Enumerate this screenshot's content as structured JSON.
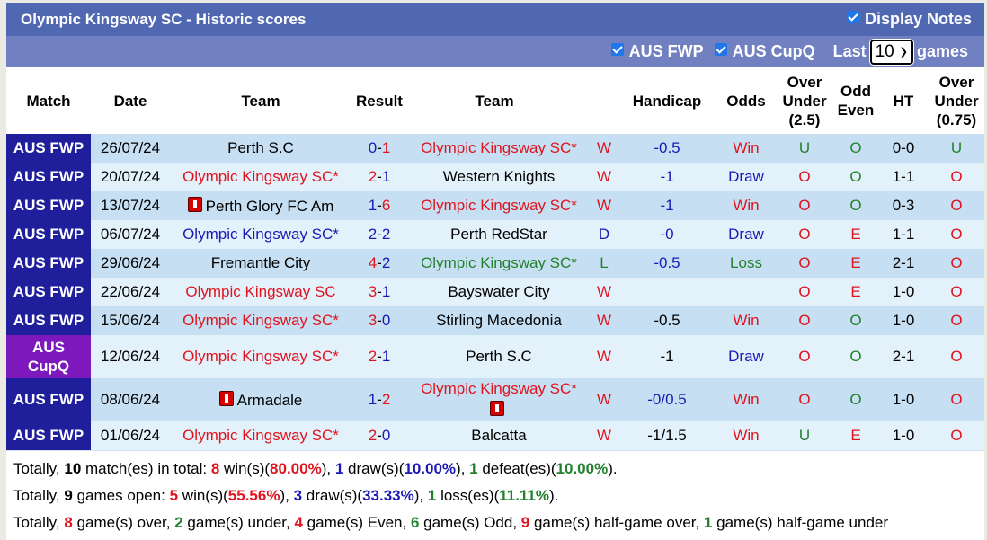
{
  "header": {
    "title": "Olympic Kingsway SC - Historic scores",
    "display_notes_label": "Display Notes",
    "display_notes_checked": true
  },
  "filters": {
    "aus_fwp_label": "AUS FWP",
    "aus_cupq_label": "AUS CupQ",
    "last_label": "Last",
    "games_count": "10",
    "games_label": "games"
  },
  "columns": {
    "match": "Match",
    "date": "Date",
    "home": "Team",
    "result": "Result",
    "away": "Team",
    "handicap": "Handicap",
    "odds": "Odds",
    "ou_l1": "Over",
    "ou_l2": "Under",
    "ou_l3": "(2.5)",
    "oe_l1": "Odd",
    "oe_l2": "Even",
    "ht": "HT",
    "ou2_l1": "Over",
    "ou2_l2": "Under",
    "ou2_l3": "(0.75)"
  },
  "rows": [
    {
      "league": "AUS FWP",
      "date": "26/07/24",
      "home": "Perth S.C",
      "home_color": "black",
      "home_card": false,
      "score_h": "0",
      "score_a": "1",
      "sh_color": "blue",
      "sa_color": "red",
      "away": "Olympic Kingsway SC*",
      "away_color": "red",
      "away_card": false,
      "wl": "W",
      "wl_color": "red",
      "handicap": "-0.5",
      "hc_color": "blue",
      "odds": "Win",
      "odds_color": "red",
      "ou": "U",
      "ou_color": "green",
      "oe": "O",
      "oe_color": "green",
      "ht": "0-0",
      "ou2": "U",
      "ou2_color": "green"
    },
    {
      "league": "AUS FWP",
      "date": "20/07/24",
      "home": "Olympic Kingsway SC*",
      "home_color": "red",
      "home_card": false,
      "score_h": "2",
      "score_a": "1",
      "sh_color": "red",
      "sa_color": "blue",
      "away": "Western Knights",
      "away_color": "black",
      "away_card": false,
      "wl": "W",
      "wl_color": "red",
      "handicap": "-1",
      "hc_color": "blue",
      "odds": "Draw",
      "odds_color": "blue",
      "ou": "O",
      "ou_color": "red",
      "oe": "O",
      "oe_color": "green",
      "ht": "1-1",
      "ou2": "O",
      "ou2_color": "red"
    },
    {
      "league": "AUS FWP",
      "date": "13/07/24",
      "home": "Perth Glory FC Am",
      "home_color": "black",
      "home_card": true,
      "score_h": "1",
      "score_a": "6",
      "sh_color": "blue",
      "sa_color": "red",
      "away": "Olympic Kingsway SC*",
      "away_color": "red",
      "away_card": false,
      "wl": "W",
      "wl_color": "red",
      "handicap": "-1",
      "hc_color": "blue",
      "odds": "Win",
      "odds_color": "red",
      "ou": "O",
      "ou_color": "red",
      "oe": "O",
      "oe_color": "green",
      "ht": "0-3",
      "ou2": "O",
      "ou2_color": "red"
    },
    {
      "league": "AUS FWP",
      "date": "06/07/24",
      "home": "Olympic Kingsway SC*",
      "home_color": "blue",
      "home_card": false,
      "score_h": "2",
      "score_a": "2",
      "sh_color": "blue",
      "sa_color": "blue",
      "away": "Perth RedStar",
      "away_color": "black",
      "away_card": false,
      "wl": "D",
      "wl_color": "blue",
      "handicap": "-0",
      "hc_color": "blue",
      "odds": "Draw",
      "odds_color": "blue",
      "ou": "O",
      "ou_color": "red",
      "oe": "E",
      "oe_color": "red",
      "ht": "1-1",
      "ou2": "O",
      "ou2_color": "red"
    },
    {
      "league": "AUS FWP",
      "date": "29/06/24",
      "home": "Fremantle City",
      "home_color": "black",
      "home_card": false,
      "score_h": "4",
      "score_a": "2",
      "sh_color": "red",
      "sa_color": "blue",
      "away": "Olympic Kingsway SC*",
      "away_color": "green",
      "away_card": false,
      "wl": "L",
      "wl_color": "green",
      "handicap": "-0.5",
      "hc_color": "blue",
      "odds": "Loss",
      "odds_color": "green",
      "ou": "O",
      "ou_color": "red",
      "oe": "E",
      "oe_color": "red",
      "ht": "2-1",
      "ou2": "O",
      "ou2_color": "red"
    },
    {
      "league": "AUS FWP",
      "date": "22/06/24",
      "home": "Olympic Kingsway SC",
      "home_color": "red",
      "home_card": false,
      "score_h": "3",
      "score_a": "1",
      "sh_color": "red",
      "sa_color": "blue",
      "away": "Bayswater City",
      "away_color": "black",
      "away_card": false,
      "wl": "W",
      "wl_color": "red",
      "handicap": "",
      "hc_color": "blue",
      "odds": "",
      "odds_color": "red",
      "ou": "O",
      "ou_color": "red",
      "oe": "E",
      "oe_color": "red",
      "ht": "1-0",
      "ou2": "O",
      "ou2_color": "red"
    },
    {
      "league": "AUS FWP",
      "date": "15/06/24",
      "home": "Olympic Kingsway SC*",
      "home_color": "red",
      "home_card": false,
      "score_h": "3",
      "score_a": "0",
      "sh_color": "red",
      "sa_color": "blue",
      "away": "Stirling Macedonia",
      "away_color": "black",
      "away_card": false,
      "wl": "W",
      "wl_color": "red",
      "handicap": "-0.5",
      "hc_color": "black",
      "odds": "Win",
      "odds_color": "red",
      "ou": "O",
      "ou_color": "red",
      "oe": "O",
      "oe_color": "green",
      "ht": "1-0",
      "ou2": "O",
      "ou2_color": "red"
    },
    {
      "league": "AUS CupQ",
      "league_l1": "AUS",
      "league_l2": "CupQ",
      "cup": true,
      "date": "12/06/24",
      "home": "Olympic Kingsway SC*",
      "home_color": "red",
      "home_card": false,
      "score_h": "2",
      "score_a": "1",
      "sh_color": "red",
      "sa_color": "blue",
      "away": "Perth S.C",
      "away_color": "black",
      "away_card": false,
      "wl": "W",
      "wl_color": "red",
      "handicap": "-1",
      "hc_color": "black",
      "odds": "Draw",
      "odds_color": "blue",
      "ou": "O",
      "ou_color": "red",
      "oe": "O",
      "oe_color": "green",
      "ht": "2-1",
      "ou2": "O",
      "ou2_color": "red"
    },
    {
      "league": "AUS FWP",
      "date": "08/06/24",
      "home": "Armadale",
      "home_color": "black",
      "home_card": true,
      "score_h": "1",
      "score_a": "2",
      "sh_color": "blue",
      "sa_color": "red",
      "away": "Olympic Kingsway SC*",
      "away_color": "red",
      "away_card": true,
      "wl": "W",
      "wl_color": "red",
      "handicap": "-0/0.5",
      "hc_color": "blue",
      "odds": "Win",
      "odds_color": "red",
      "ou": "O",
      "ou_color": "red",
      "oe": "O",
      "oe_color": "green",
      "ht": "1-0",
      "ou2": "O",
      "ou2_color": "red"
    },
    {
      "league": "AUS FWP",
      "date": "01/06/24",
      "home": "Olympic Kingsway SC*",
      "home_color": "red",
      "home_card": false,
      "score_h": "2",
      "score_a": "0",
      "sh_color": "red",
      "sa_color": "blue",
      "away": "Balcatta",
      "away_color": "black",
      "away_card": false,
      "wl": "W",
      "wl_color": "red",
      "handicap": "-1/1.5",
      "hc_color": "black",
      "odds": "Win",
      "odds_color": "red",
      "ou": "U",
      "ou_color": "green",
      "oe": "E",
      "oe_color": "red",
      "ht": "1-0",
      "ou2": "O",
      "ou2_color": "red"
    }
  ],
  "summary": {
    "line1": [
      {
        "t": "Totally, ",
        "c": "black",
        "b": false
      },
      {
        "t": "10",
        "c": "black",
        "b": true
      },
      {
        "t": " match(es) in total: ",
        "c": "black",
        "b": false
      },
      {
        "t": "8",
        "c": "red",
        "b": true
      },
      {
        "t": " win(s)(",
        "c": "black",
        "b": false
      },
      {
        "t": "80.00%",
        "c": "red",
        "b": true
      },
      {
        "t": "), ",
        "c": "black",
        "b": false
      },
      {
        "t": "1",
        "c": "blue",
        "b": true
      },
      {
        "t": " draw(s)(",
        "c": "black",
        "b": false
      },
      {
        "t": "10.00%",
        "c": "blue",
        "b": true
      },
      {
        "t": "), ",
        "c": "black",
        "b": false
      },
      {
        "t": "1",
        "c": "green",
        "b": true
      },
      {
        "t": " defeat(es)(",
        "c": "black",
        "b": false
      },
      {
        "t": "10.00%",
        "c": "green",
        "b": true
      },
      {
        "t": ").",
        "c": "black",
        "b": false
      }
    ],
    "line2": [
      {
        "t": "Totally, ",
        "c": "black",
        "b": false
      },
      {
        "t": "9",
        "c": "black",
        "b": true
      },
      {
        "t": " games open: ",
        "c": "black",
        "b": false
      },
      {
        "t": "5",
        "c": "red",
        "b": true
      },
      {
        "t": " win(s)(",
        "c": "black",
        "b": false
      },
      {
        "t": "55.56%",
        "c": "red",
        "b": true
      },
      {
        "t": "), ",
        "c": "black",
        "b": false
      },
      {
        "t": "3",
        "c": "blue",
        "b": true
      },
      {
        "t": " draw(s)(",
        "c": "black",
        "b": false
      },
      {
        "t": "33.33%",
        "c": "blue",
        "b": true
      },
      {
        "t": "), ",
        "c": "black",
        "b": false
      },
      {
        "t": "1",
        "c": "green",
        "b": true
      },
      {
        "t": " loss(es)(",
        "c": "black",
        "b": false
      },
      {
        "t": "11.11%",
        "c": "green",
        "b": true
      },
      {
        "t": ").",
        "c": "black",
        "b": false
      }
    ],
    "line3": [
      {
        "t": "Totally, ",
        "c": "black",
        "b": false
      },
      {
        "t": "8",
        "c": "red",
        "b": true
      },
      {
        "t": " game(s) over, ",
        "c": "black",
        "b": false
      },
      {
        "t": "2",
        "c": "green",
        "b": true
      },
      {
        "t": " game(s) under, ",
        "c": "black",
        "b": false
      },
      {
        "t": "4",
        "c": "red",
        "b": true
      },
      {
        "t": " game(s) Even, ",
        "c": "black",
        "b": false
      },
      {
        "t": "6",
        "c": "green",
        "b": true
      },
      {
        "t": " game(s) Odd, ",
        "c": "black",
        "b": false
      },
      {
        "t": "9",
        "c": "red",
        "b": true
      },
      {
        "t": " game(s) half-game over, ",
        "c": "black",
        "b": false
      },
      {
        "t": "1",
        "c": "green",
        "b": true
      },
      {
        "t": " game(s) half-game under",
        "c": "black",
        "b": false
      }
    ]
  }
}
